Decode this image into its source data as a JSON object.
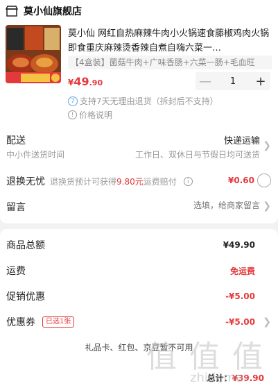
{
  "shop": {
    "name": "莫小仙旗舰店"
  },
  "product": {
    "title": "莫小仙 网红自热麻辣牛肉小火锅速食藤椒鸡肉火锅即食重庆麻辣烫香辣自煮自嗨六菜一…",
    "sku": "【4盒装】菌菇牛肉+广味香肠+六菜一肠+毛血旺",
    "price_symbol": "¥",
    "price_int": "49",
    "price_dec": ".90",
    "quantity": "1",
    "minus": "—",
    "plus": "+",
    "service_num": "7",
    "service_text": "支持7天无理由退货（拆封后不支持）",
    "price_explain": "价格说明",
    "thumb_price_tag": "44.9",
    "thumb_badge": "5"
  },
  "shipping": {
    "label": "配送",
    "method": "快递运输",
    "sub": "中小件送货时间",
    "time": "工作日、双休日与节假日均可送货"
  },
  "return_service": {
    "label": "退换无忧",
    "desc_prefix": "退换货预计可获得",
    "desc_amount": "9.80元",
    "desc_suffix": "运费赔付",
    "price": "¥0.60"
  },
  "note": {
    "label": "留言",
    "placeholder": "选填，给商家留言"
  },
  "summary": {
    "total_label": "商品总额",
    "total_value": "¥49.90",
    "freight_label": "运费",
    "freight_value": "免运费",
    "promo_label": "促销优惠",
    "promo_value": "-¥5.00",
    "coupon_label": "优惠券",
    "coupon_badge": "已选1张",
    "coupon_value": "-¥5.00",
    "footnote": "礼品卡、红包、京豆暂不可用"
  },
  "total": {
    "label": "总计：",
    "amount": "¥39.90"
  },
  "watermark": {
    "logo": "值 值 值",
    "url": "zhidemai"
  },
  "colors": {
    "accent": "#e4393c",
    "service_blue": "#5aa9e6"
  }
}
